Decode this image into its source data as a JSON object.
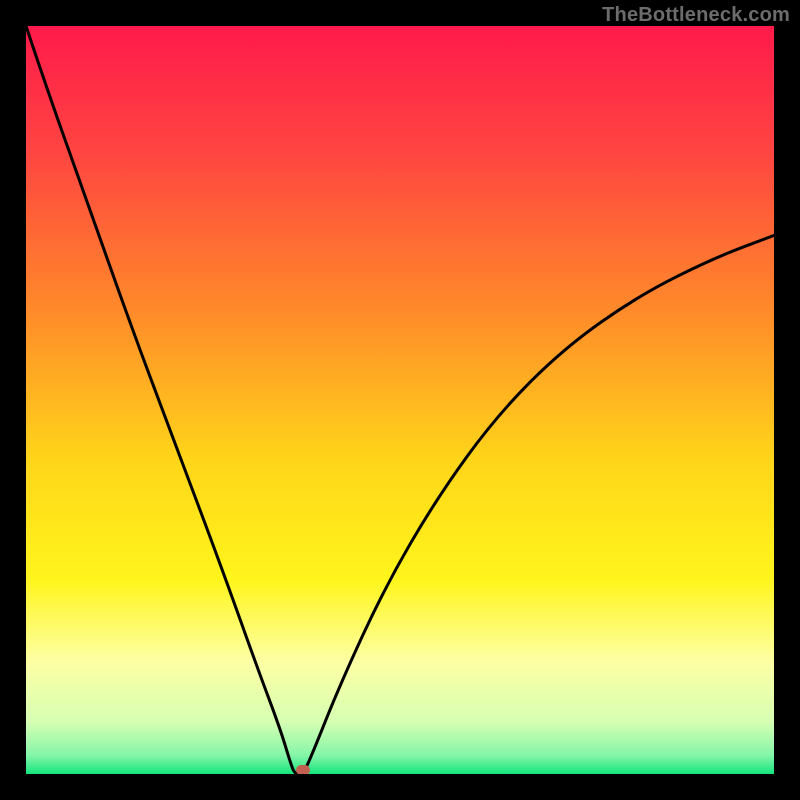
{
  "watermark": "TheBottleneck.com",
  "chart_data": {
    "type": "line",
    "title": "",
    "xlabel": "",
    "ylabel": "",
    "xlim": [
      0,
      100
    ],
    "ylim": [
      0,
      100
    ],
    "background_gradient_stops": [
      {
        "pos": 0.0,
        "color": "#ff1a4b"
      },
      {
        "pos": 0.18,
        "color": "#ff4840"
      },
      {
        "pos": 0.38,
        "color": "#ff8a2a"
      },
      {
        "pos": 0.58,
        "color": "#ffd519"
      },
      {
        "pos": 0.74,
        "color": "#fff51c"
      },
      {
        "pos": 0.85,
        "color": "#fdffa4"
      },
      {
        "pos": 0.93,
        "color": "#d6ffb2"
      },
      {
        "pos": 0.975,
        "color": "#85f5a8"
      },
      {
        "pos": 1.0,
        "color": "#15e57e"
      }
    ],
    "series": [
      {
        "name": "bottleneck-curve",
        "color": "#000000",
        "type": "line",
        "points": [
          {
            "x": 0.0,
            "y": 100.0
          },
          {
            "x": 3.0,
            "y": 91.0
          },
          {
            "x": 8.0,
            "y": 77.0
          },
          {
            "x": 14.0,
            "y": 60.0
          },
          {
            "x": 20.0,
            "y": 44.0
          },
          {
            "x": 26.0,
            "y": 28.0
          },
          {
            "x": 31.0,
            "y": 14.0
          },
          {
            "x": 34.0,
            "y": 6.0
          },
          {
            "x": 35.5,
            "y": 1.0
          },
          {
            "x": 36.0,
            "y": 0.0
          },
          {
            "x": 37.0,
            "y": 0.0
          },
          {
            "x": 38.0,
            "y": 2.0
          },
          {
            "x": 42.0,
            "y": 12.0
          },
          {
            "x": 48.0,
            "y": 25.0
          },
          {
            "x": 55.0,
            "y": 37.0
          },
          {
            "x": 63.0,
            "y": 48.0
          },
          {
            "x": 72.0,
            "y": 57.0
          },
          {
            "x": 82.0,
            "y": 64.0
          },
          {
            "x": 92.0,
            "y": 69.0
          },
          {
            "x": 100.0,
            "y": 72.0
          }
        ]
      }
    ],
    "marker": {
      "x": 37.0,
      "y": 0.5,
      "color": "#c26052"
    }
  }
}
